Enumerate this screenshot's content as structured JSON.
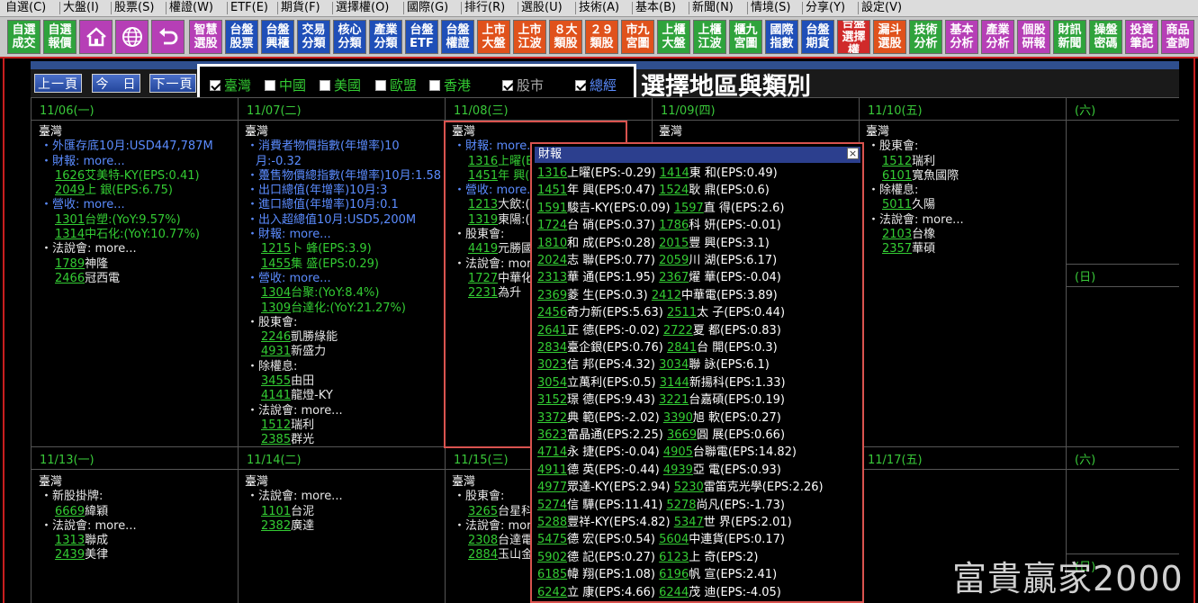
{
  "menu": [
    "自選(C)",
    "大盤(I)",
    "股票(S)",
    "權證(W)",
    "ETF(E)",
    "期貨(F)",
    "選擇權(O)",
    "國際(G)",
    "排行(R)",
    "選股(U)",
    "技術(A)",
    "基本(B)",
    "新聞(N)",
    "情境(S)",
    "分享(Y)",
    "設定(V)"
  ],
  "toolbar": {
    "b1": "自選\n成交",
    "b2": "自選\n報價",
    "home_icon": "home-icon",
    "globe_icon": "globe-icon",
    "back_icon": "back-icon",
    "b6": "智慧\n選股",
    "b7": "台盤\n股票",
    "b8": "台盤\n興櫃",
    "b9": "交易\n分類",
    "b10": "核心\n分類",
    "b11": "產業\n分類",
    "b12": "台盤\nETF",
    "b13": "台盤\n權證",
    "b14": "上市\n大盤",
    "b15": "上市\n江波",
    "b16": "８大\n類股",
    "b17": "２９\n類股",
    "b18": "市九\n宮圖",
    "b19": "上櫃\n大盤",
    "b20": "上櫃\n江波",
    "b21": "櫃九\n宮圖",
    "b22": "國際\n指數",
    "b23": "台盤\n期貨",
    "b24": "台盤\n選擇權",
    "b25": "漏斗\n選股",
    "b26": "技術\n分析",
    "b27": "基本\n分析",
    "b28": "產業\n分析",
    "b29": "個股\n研報",
    "b30": "財訊\n新聞",
    "b31": "操盤\n密碼",
    "b32": "投資\n筆記",
    "b33": "商品\n查詢"
  },
  "nav": {
    "prev": "上一頁",
    "today": "今　日",
    "next": "下一頁"
  },
  "filters": [
    {
      "label": "臺灣",
      "checked": true
    },
    {
      "label": "中國",
      "checked": false
    },
    {
      "label": "美國",
      "checked": false
    },
    {
      "label": "歐盟",
      "checked": false
    },
    {
      "label": "香港",
      "checked": false
    },
    {
      "label": "股市",
      "checked": true
    },
    {
      "label": "總經",
      "checked": true
    }
  ],
  "annotation": "選擇地區與類別",
  "days": {
    "d1": "11/06(一)",
    "d2": "11/07(二)",
    "d3": "11/08(三)",
    "d4": "11/09(四)",
    "d5": "11/10(五)",
    "d6": "(六)",
    "d7": "(日)",
    "d8": "11/13(一)",
    "d9": "11/14(二)",
    "d10": "11/15(三)",
    "d11": "11/16(四)",
    "d12": "11/17(五)",
    "d13": "(六)",
    "d14": "(日)"
  },
  "cells": {
    "c1": [
      "臺灣",
      "・外匯存底10月:USD447,787M",
      "・財報: more...",
      "1626艾美特-KY(EPS:0.41)",
      "2049上 銀(EPS:6.75)",
      "・營收: more...",
      "1301台塑:(YoY:9.57%)",
      "1314中石化:(YoY:10.77%)",
      "・法說會: more...",
      "1789神隆",
      "2466冠西電"
    ],
    "c2": [
      "臺灣",
      "・消費者物價指數(年增率)10",
      "月:-0.32",
      "・躉售物價總指數(年增率)10月:1.58",
      "・出口總值(年增率)10月:3",
      "・進口總值(年增率)10月:0.1",
      "・出入超總值10月:USD5,200M",
      "・財報: more...",
      "1215卜 蜂(EPS:3.9)",
      "1455集 盛(EPS:0.29)",
      "・營收: more...",
      "1304台聚:(YoY:8.4%)",
      "1309台達化:(YoY:21.27%)",
      "・股東會:",
      "2246凱勝綠能",
      "4931新盛力",
      "・除權息:",
      "3455由田",
      "4141龍燈-KY",
      "・法說會: more...",
      "1512瑞利",
      "2385群光"
    ],
    "c3": [
      "臺灣",
      "・財報: more...",
      "1316上曜(EPS",
      "1451年 興(EPS",
      "・營收: more...",
      "1213大飲:(Yo",
      "1319東陽:(Yo",
      "・股東會:",
      "4419元勝國際",
      "・法說會: more.",
      "1727中華化",
      "2231為升"
    ],
    "c4": [
      "臺灣"
    ],
    "c5": [
      "臺灣",
      "・股東會:",
      "1512瑞利",
      "6101寬魚國際",
      "・除權息:",
      "5011久陽",
      "・法說會: more...",
      "2103台橡",
      "2357華碩"
    ],
    "c8": [
      "臺灣",
      "・新股掛牌:",
      "6669緯穎",
      "・法說會: more...",
      "1313聯成",
      "2439美律"
    ],
    "c9": [
      "臺灣",
      "・法說會: more...",
      "1101台泥",
      "2382廣達"
    ],
    "c10": [
      "臺灣",
      "・股東會:",
      "3265台星科",
      "・法說會: more.",
      "2308台達電",
      "2884玉山金"
    ]
  },
  "popup": {
    "title": "財報",
    "close_icon": "close-icon",
    "rows": [
      [
        "1316上曜(EPS:-0.29)",
        "1414東 和(EPS:0.49)"
      ],
      [
        "1451年 興(EPS:0.47)",
        "1524耿 鼎(EPS:0.6)"
      ],
      [
        "1591駿吉-KY(EPS:0.09)",
        "1597直 得(EPS:2.6)"
      ],
      [
        "1724台 硝(EPS:0.37)",
        "1786科 妍(EPS:-0.01)"
      ],
      [
        "1810和 成(EPS:0.28)",
        "2015豐 興(EPS:3.1)"
      ],
      [
        "2024志 聯(EPS:0.77)",
        "2059川 湖(EPS:6.17)"
      ],
      [
        "2313華 通(EPS:1.95)",
        "2367燿 華(EPS:-0.04)"
      ],
      [
        "2369菱 生(EPS:0.3)",
        "2412中華電(EPS:3.89)"
      ],
      [
        "2456奇力新(EPS:5.63)",
        "2511太 子(EPS:0.44)"
      ],
      [
        "2641正 德(EPS:-0.02)",
        "2722夏 都(EPS:0.83)"
      ],
      [
        "2834臺企銀(EPS:0.76)",
        "2841台 開(EPS:0.3)"
      ],
      [
        "3023信 邦(EPS:4.32)",
        "3034聯 詠(EPS:6.1)"
      ],
      [
        "3054立萬利(EPS:0.5)",
        "3144新揚科(EPS:1.33)"
      ],
      [
        "3152璟 德(EPS:9.43)",
        "3221台嘉碩(EPS:0.19)"
      ],
      [
        "3372典 範(EPS:-2.02)",
        "3390旭 軟(EPS:0.27)"
      ],
      [
        "3623富晶通(EPS:2.25)",
        "3669圓 展(EPS:0.66)"
      ],
      [
        "4714永 捷(EPS:-0.04)",
        "4905台聯電(EPS:14.82)"
      ],
      [
        "4911德 英(EPS:-0.44)",
        "4939亞 電(EPS:0.93)"
      ],
      [
        "4977眾達-KY(EPS:2.94)",
        "5230雷笛克光學(EPS:2.26)"
      ],
      [
        "5274信 驊(EPS:11.41)",
        "5278尚凡(EPS:-1.73)"
      ],
      [
        "5288豐祥-KY(EPS:4.82)",
        "5347世 界(EPS:2.01)"
      ],
      [
        "5475德 宏(EPS:0.54)",
        "5604中連貨(EPS:0.17)"
      ],
      [
        "5902德 記(EPS:0.27)",
        "6123上 奇(EPS:2)"
      ],
      [
        "6185幃 翔(EPS:1.08)",
        "6196帆 宣(EPS:2.41)"
      ],
      [
        "6242立 康(EPS:4.66)",
        "6244茂 迪(EPS:-4.05)"
      ]
    ]
  },
  "watermark": "富貴贏家2000",
  "colors": {
    "accent_red": "#c81e1e",
    "header_blue": "#2c3f8e",
    "green": "#33cc33",
    "macro_blue": "#5b8cff"
  }
}
